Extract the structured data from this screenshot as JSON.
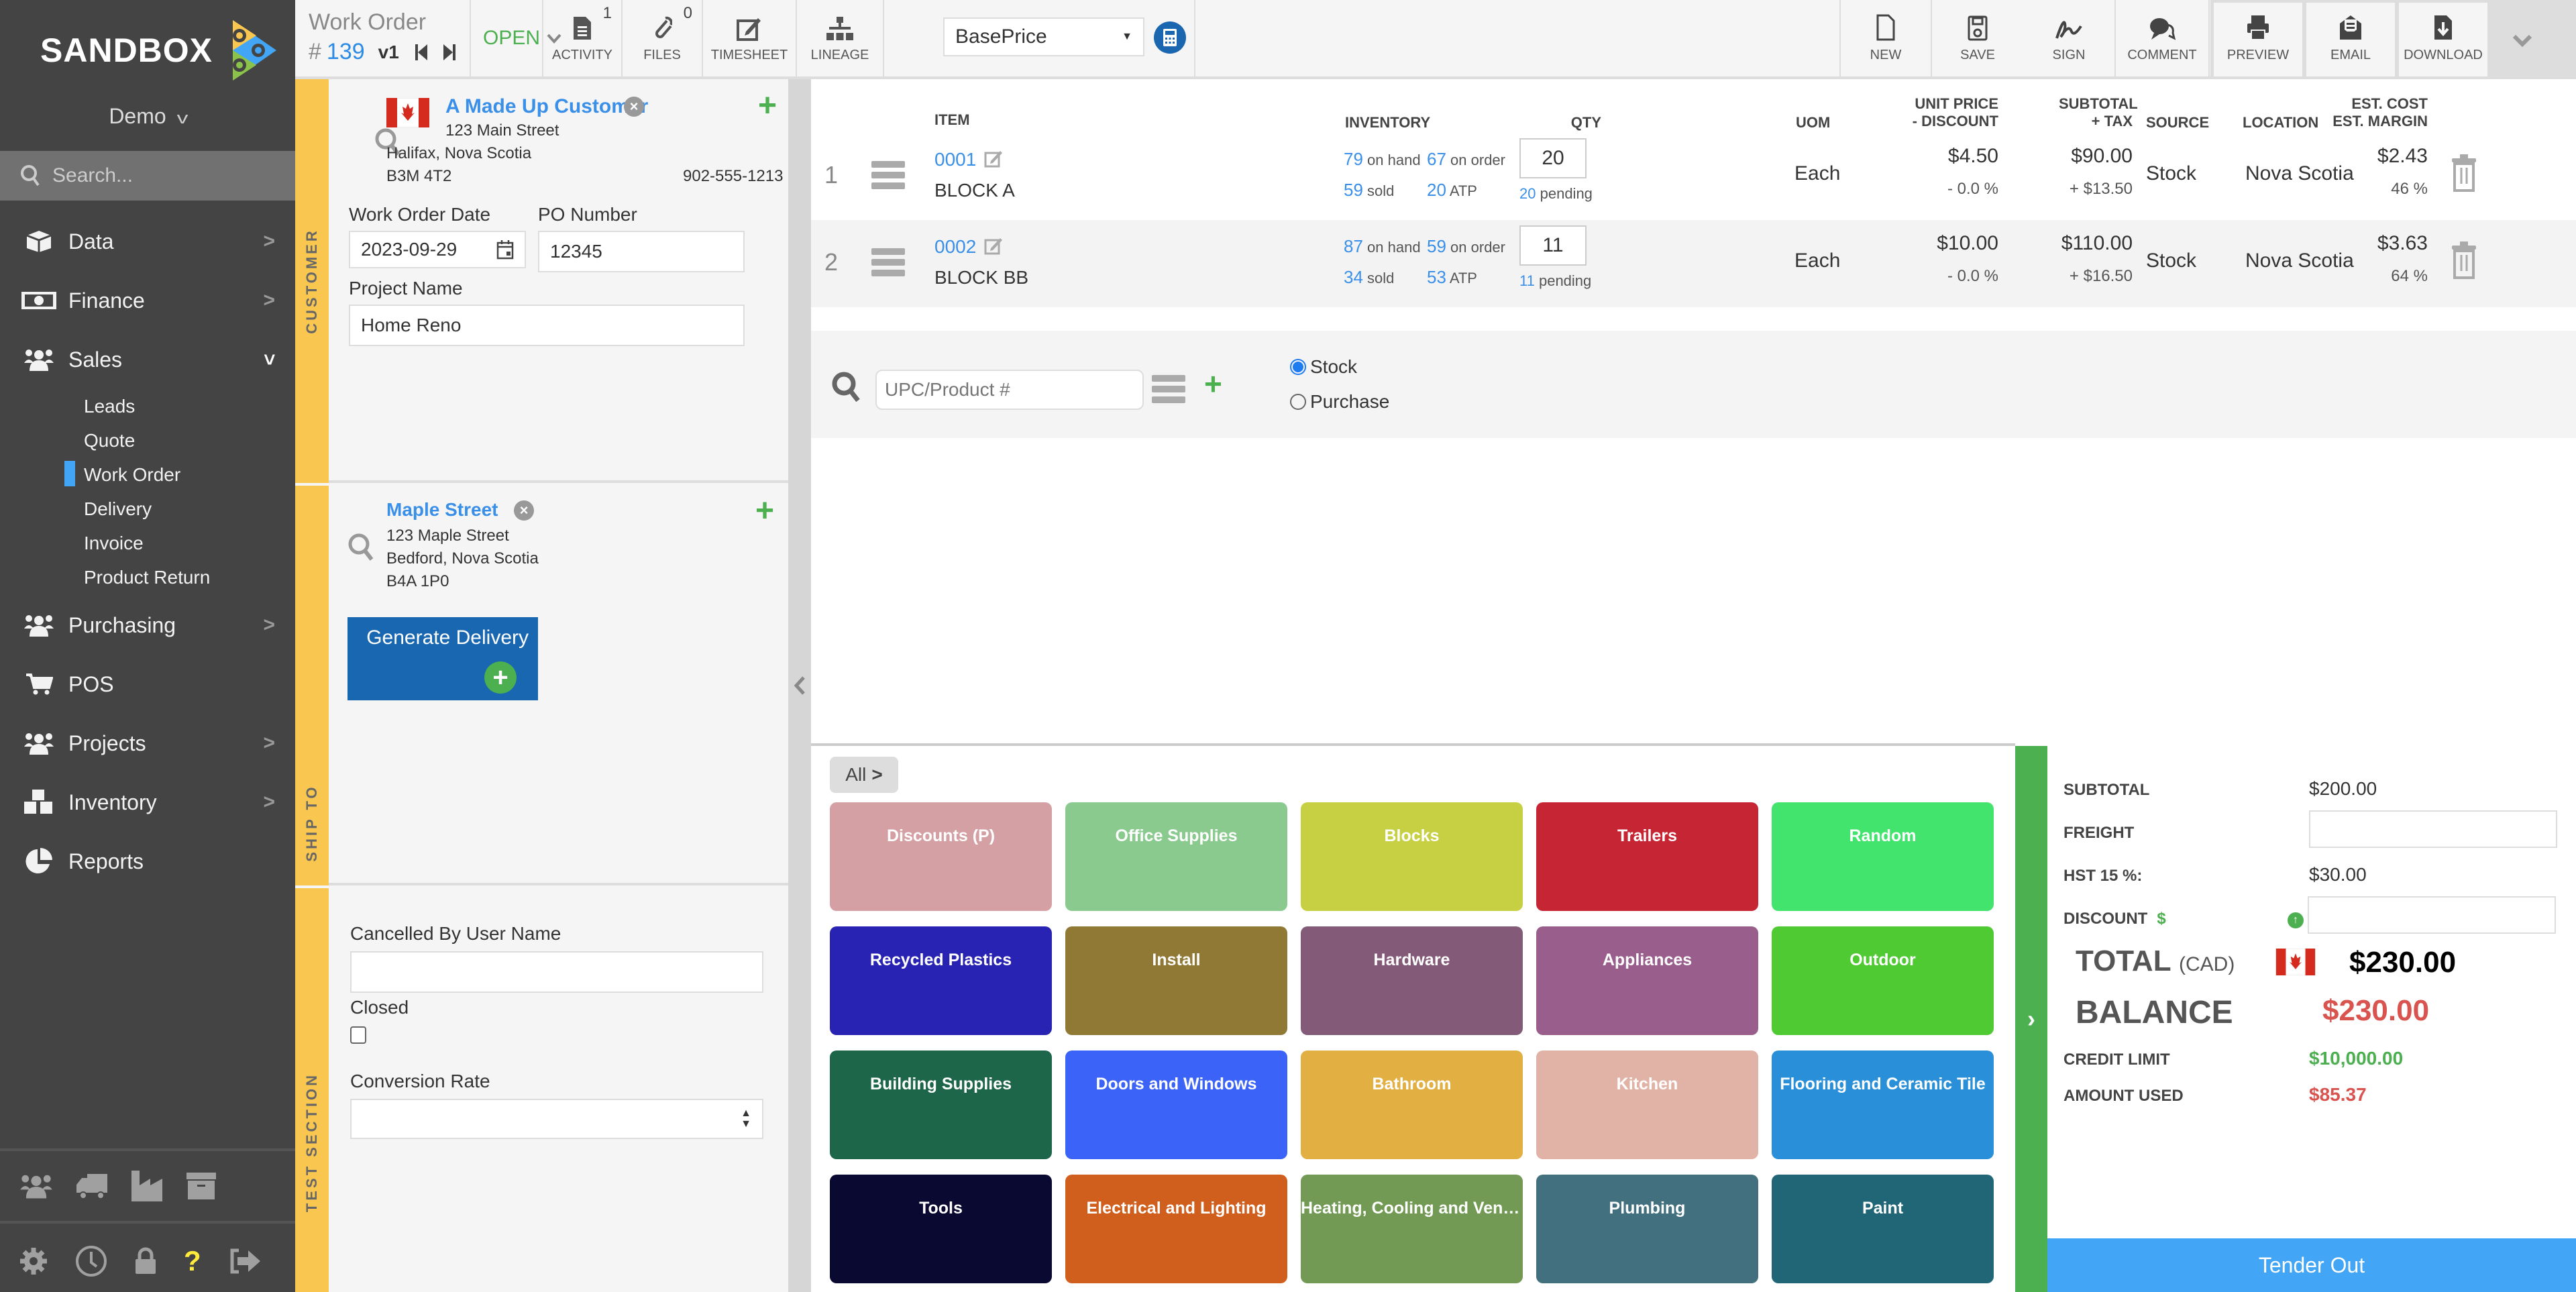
{
  "app": {
    "logo_text": "SANDBOX",
    "org": "Demo"
  },
  "sidebar": {
    "search_placeholder": "Search...",
    "items": [
      {
        "label": "Data",
        "icon": "cube-icon",
        "has_arrow": true
      },
      {
        "label": "Finance",
        "icon": "money-icon",
        "has_arrow": true
      },
      {
        "label": "Sales",
        "icon": "users-icon",
        "expanded": true
      },
      {
        "label": "Purchasing",
        "icon": "users-icon",
        "has_arrow": true
      },
      {
        "label": "POS",
        "icon": "cart-icon",
        "has_arrow": false
      },
      {
        "label": "Projects",
        "icon": "users-icon",
        "has_arrow": true
      },
      {
        "label": "Inventory",
        "icon": "cubes-icon",
        "has_arrow": true
      },
      {
        "label": "Reports",
        "icon": "pie-chart-icon",
        "has_arrow": false
      }
    ],
    "sales_sub": [
      "Leads",
      "Quote",
      "Work Order",
      "Delivery",
      "Invoice",
      "Product Return"
    ],
    "active_sub": "Work Order",
    "accent": "#42a5f5"
  },
  "toolbar": {
    "doc_type": "Work Order",
    "hash": "#",
    "doc_number": "139",
    "version": "v1",
    "status": "OPEN",
    "activity": {
      "label": "ACTIVITY",
      "count": "1"
    },
    "files": {
      "label": "FILES",
      "count": "0"
    },
    "timesheet": "TIMESHEET",
    "lineage": "LINEAGE",
    "price_list": "BasePrice",
    "new": "NEW",
    "save": "SAVE",
    "sign": "SIGN",
    "comment": "COMMENT",
    "preview": "PREVIEW",
    "email": "EMAIL",
    "download": "DOWNLOAD"
  },
  "customer": {
    "section_label": "CUSTOMER",
    "name": "A Made Up Customer",
    "street": "123 Main Street",
    "city": "Halifax, Nova Scotia",
    "postal": "B3M 4T2",
    "phone": "902-555-1213",
    "date_label": "Work Order Date",
    "date": "2023-09-29",
    "po_label": "PO Number",
    "po": "12345",
    "project_label": "Project Name",
    "project": "Home Reno"
  },
  "ship_to": {
    "section_label": "SHIP TO",
    "name": "Maple Street",
    "street": "123 Maple Street",
    "city": "Bedford, Nova Scotia",
    "postal": "B4A 1P0",
    "generate_label": "Generate Delivery"
  },
  "test_section": {
    "section_label": "TEST SECTION",
    "cancelled_label": "Cancelled By User Name",
    "cancelled_value": "",
    "closed_label": "Closed",
    "closed_checked": false,
    "conversion_label": "Conversion Rate",
    "conversion_value": ""
  },
  "table": {
    "headers": {
      "item": "ITEM",
      "inventory": "INVENTORY",
      "qty": "QTY",
      "uom": "UOM",
      "unit_price": "UNIT PRICE",
      "discount": "- DISCOUNT",
      "subtotal": "SUBTOTAL",
      "tax": "+ TAX",
      "source": "SOURCE",
      "location": "LOCATION",
      "est_cost": "EST. COST",
      "est_margin": "EST. MARGIN"
    },
    "rows": [
      {
        "num": "1",
        "code": "0001",
        "name": "BLOCK A",
        "on_hand": "79",
        "on_order": "67",
        "sold": "59",
        "atp": "20",
        "qty": "20",
        "pending": "20",
        "uom": "Each",
        "price": "$4.50",
        "discount": "- 0.0 %",
        "subtotal": "$90.00",
        "tax": "+ $13.50",
        "source": "Stock",
        "location": "Nova Scotia",
        "cost": "$2.43",
        "margin": "46 %"
      },
      {
        "num": "2",
        "code": "0002",
        "name": "BLOCK BB",
        "on_hand": "87",
        "on_order": "59",
        "sold": "34",
        "atp": "53",
        "qty": "11",
        "pending": "11",
        "uom": "Each",
        "price": "$10.00",
        "discount": "- 0.0 %",
        "subtotal": "$110.00",
        "tax": "+ $16.50",
        "source": "Stock",
        "location": "Nova Scotia",
        "cost": "$3.63",
        "margin": "64 %"
      }
    ],
    "labels": {
      "on_hand": "on hand",
      "on_order": "on order",
      "sold": "sold",
      "atp": "ATP",
      "pending": "pending"
    }
  },
  "add_item": {
    "placeholder": "UPC/Product #",
    "source_options": [
      "Stock",
      "Purchase"
    ],
    "selected_source": "Stock"
  },
  "categories": {
    "breadcrumb": "All",
    "tiles": [
      {
        "label": "Discounts (P)",
        "color": "#d5a0a3"
      },
      {
        "label": "Office Supplies",
        "color": "#8aca8f"
      },
      {
        "label": "Blocks",
        "color": "#c7cf42"
      },
      {
        "label": "Trailers",
        "color": "#c62634"
      },
      {
        "label": "Random",
        "color": "#42e46d"
      },
      {
        "label": "Recycled Plastics",
        "color": "#2823b2"
      },
      {
        "label": "Install",
        "color": "#8f7935"
      },
      {
        "label": "Hardware",
        "color": "#835a77"
      },
      {
        "label": "Appliances",
        "color": "#995e8c"
      },
      {
        "label": "Outdoor",
        "color": "#4fca33"
      },
      {
        "label": "Building Supplies",
        "color": "#1e6649"
      },
      {
        "label": "Doors and Windows",
        "color": "#3c63f7"
      },
      {
        "label": "Bathroom",
        "color": "#e1af42"
      },
      {
        "label": "Kitchen",
        "color": "#e1b2a6"
      },
      {
        "label": "Flooring and Ceramic Tile",
        "color": "#298fd8"
      },
      {
        "label": "Tools",
        "color": "#0a0932"
      },
      {
        "label": "Electrical and Lighting",
        "color": "#d05f1e"
      },
      {
        "label": "Heating, Cooling and Ventil...",
        "color": "#729a54"
      },
      {
        "label": "Plumbing",
        "color": "#43707e"
      },
      {
        "label": "Paint",
        "color": "#216676"
      }
    ]
  },
  "totals": {
    "subtotal_label": "SUBTOTAL",
    "subtotal": "$200.00",
    "freight_label": "FREIGHT",
    "freight": "",
    "tax_label": "HST 15 %:",
    "tax": "$30.00",
    "discount_label": "DISCOUNT",
    "discount_symbol": "$",
    "discount": "",
    "total_label": "TOTAL",
    "currency": "(CAD)",
    "total": "$230.00",
    "balance_label": "BALANCE",
    "balance": "$230.00",
    "credit_limit_label": "CREDIT LIMIT",
    "credit_limit": "$10,000.00",
    "amount_used_label": "AMOUNT USED",
    "amount_used": "$85.37",
    "tender_label": "Tender Out",
    "colors": {
      "positive": "#4caf50",
      "negative": "#d9534f"
    }
  }
}
